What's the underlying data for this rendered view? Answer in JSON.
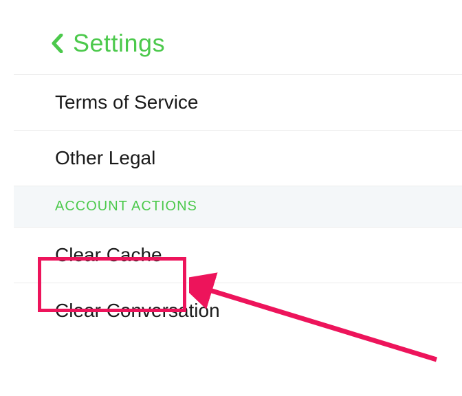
{
  "header": {
    "title": "Settings"
  },
  "items": [
    {
      "label": "Terms of Service"
    },
    {
      "label": "Other Legal"
    }
  ],
  "section": {
    "label": "ACCOUNT ACTIONS"
  },
  "account_actions": [
    {
      "label": "Clear Cache"
    },
    {
      "label": "Clear Conversation"
    }
  ],
  "colors": {
    "accent": "#4cc94c",
    "highlight": "#ed145b"
  }
}
